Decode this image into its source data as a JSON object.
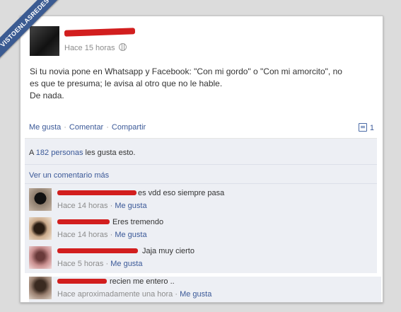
{
  "watermark": "VISTOENLASREDES",
  "post": {
    "timestamp": "Hace 15 horas",
    "lines": [
      "Si tu novia pone en Whatsapp y Facebook: \"Con mi gordo\" o \"Con mi amorcito\", no",
      "es que te presuma; le avisa al otro que no le hable.",
      "De nada."
    ]
  },
  "actions": {
    "like": "Me gusta",
    "comment": "Comentar",
    "share": "Compartir",
    "separator": "·",
    "comment_count": "1"
  },
  "likes": {
    "prefix": "A",
    "count_text": "182 personas",
    "suffix": "les gusta esto."
  },
  "more_comments": "Ver un comentario más",
  "comments": [
    {
      "text": "es vdd eso siempre pasa",
      "time": "Hace 14 horas",
      "like": "Me gusta"
    },
    {
      "text": "Eres tremendo",
      "time": "Hace 14 horas",
      "like": "Me gusta"
    },
    {
      "text": "Jaja muy cierto",
      "time": "Hace 5 horas",
      "like": "Me gusta"
    },
    {
      "text": "recien me entero ..",
      "time": "Hace aproximadamente una hora",
      "like": "Me gusta"
    }
  ],
  "meta_separator": "·",
  "colors": {
    "link": "#3b5998",
    "redaction": "#d21e1e",
    "watermark": "#3b5b92"
  }
}
